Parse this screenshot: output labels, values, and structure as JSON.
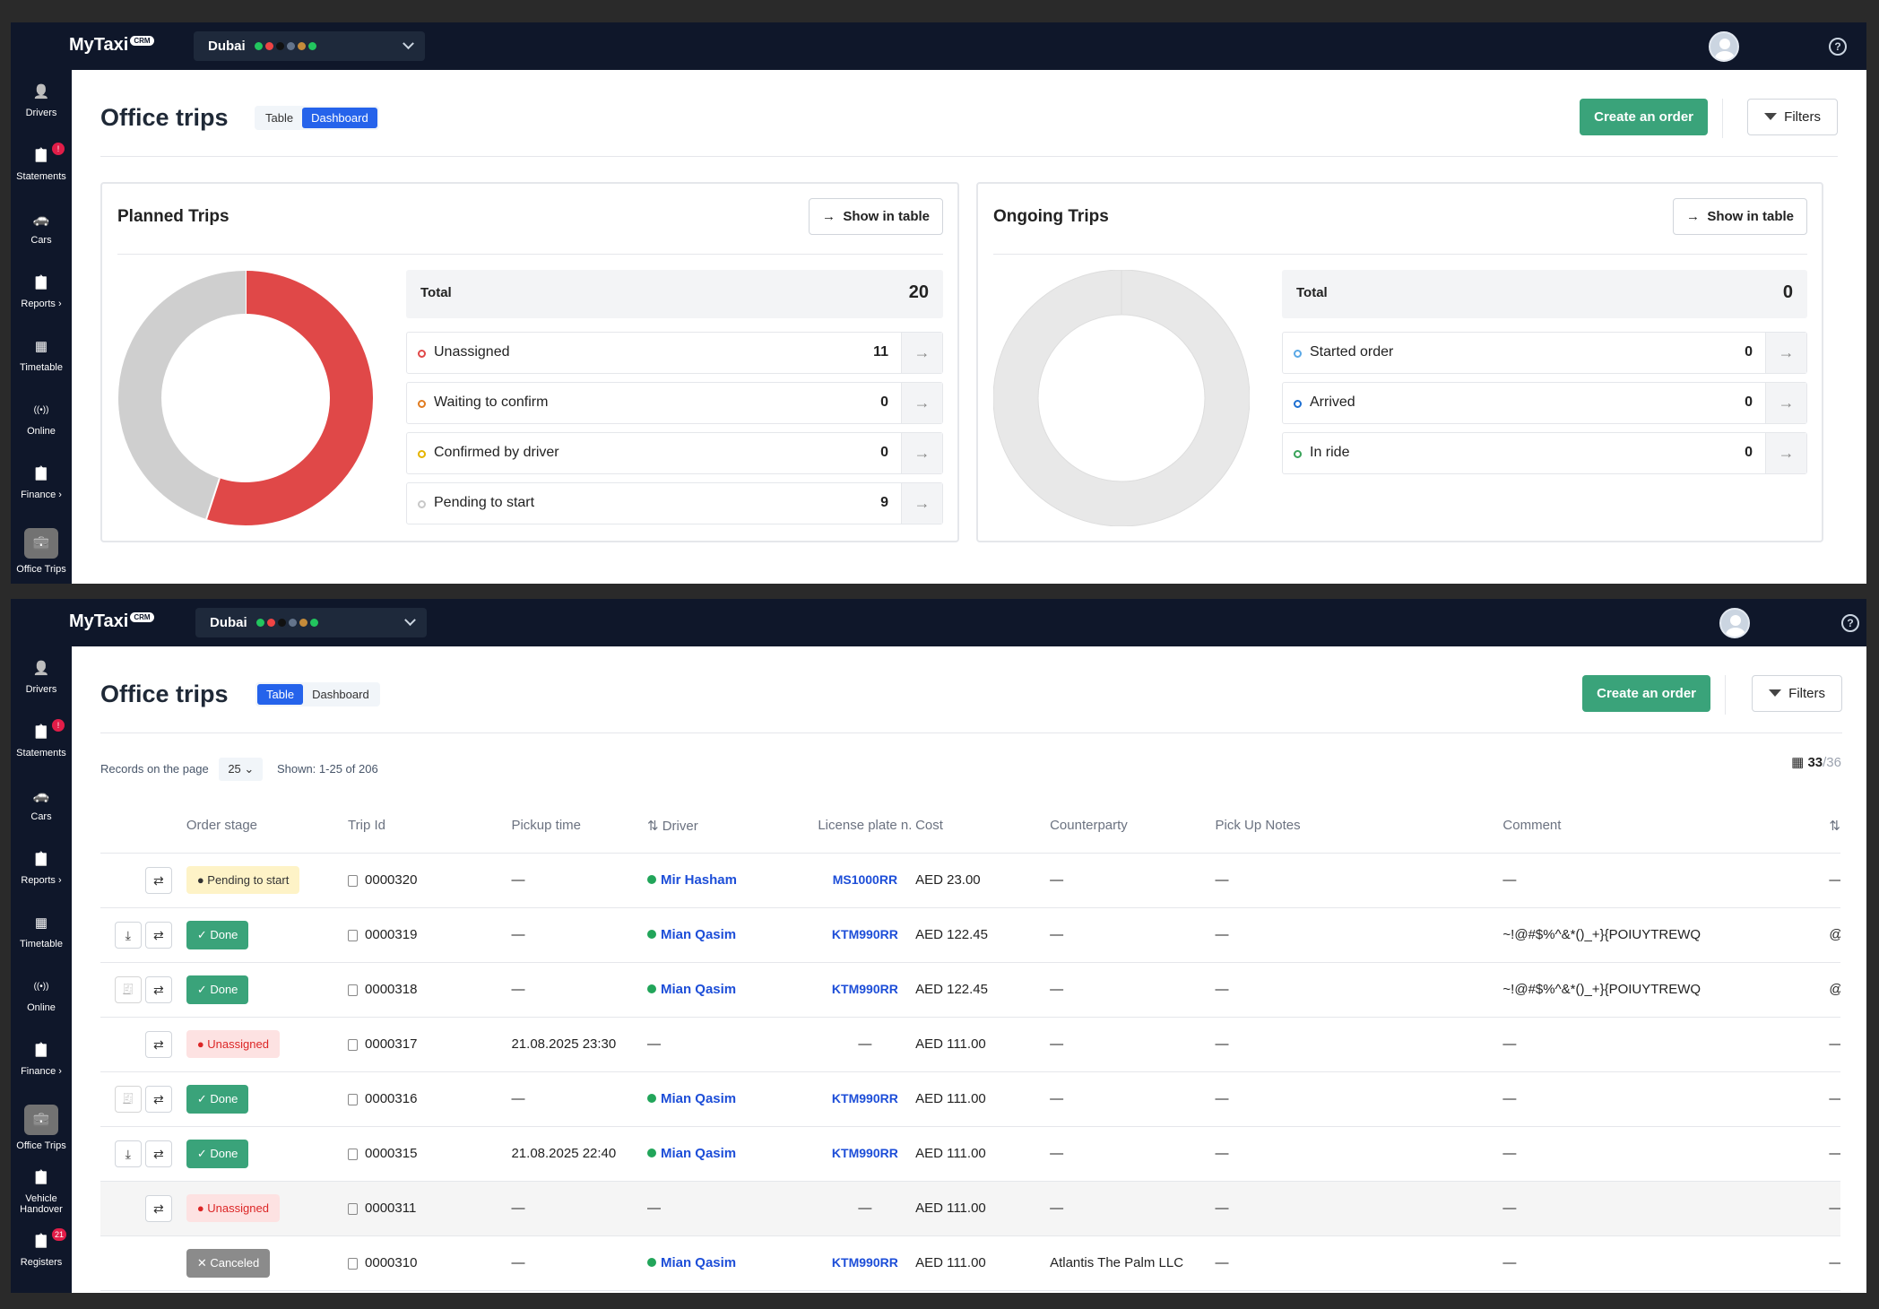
{
  "app": {
    "logo": "MyTaxi",
    "logo_badge": "CRM",
    "city": "Dubai",
    "help": "?"
  },
  "sidebar": {
    "frame1": [
      {
        "label": "Drivers",
        "icon": "user-icon"
      },
      {
        "label": "Statements",
        "icon": "clipboard-icon",
        "badge": "!"
      },
      {
        "label": "Cars",
        "icon": "car-icon"
      },
      {
        "label": "Reports ›",
        "icon": "clipboard-icon"
      },
      {
        "label": "Timetable",
        "icon": "calendar-icon"
      },
      {
        "label": "Online",
        "icon": "broadcast-icon"
      },
      {
        "label": "Finance ›",
        "icon": "clipboard-icon"
      },
      {
        "label": "Office Trips",
        "icon": "briefcase-icon",
        "active": true
      }
    ],
    "frame2": [
      {
        "label": "Drivers",
        "icon": "user-icon"
      },
      {
        "label": "Statements",
        "icon": "clipboard-icon",
        "badge": "!"
      },
      {
        "label": "Cars",
        "icon": "car-icon"
      },
      {
        "label": "Reports ›",
        "icon": "clipboard-icon"
      },
      {
        "label": "Timetable",
        "icon": "calendar-icon"
      },
      {
        "label": "Online",
        "icon": "broadcast-icon"
      },
      {
        "label": "Finance ›",
        "icon": "clipboard-icon"
      },
      {
        "label": "Office Trips",
        "icon": "briefcase-icon",
        "active": true
      },
      {
        "label": "Vehicle Handover",
        "icon": "clipboard-icon"
      },
      {
        "label": "Registers",
        "icon": "clipboard-icon",
        "badge": "21"
      }
    ]
  },
  "page": {
    "title": "Office trips",
    "tab_table": "Table",
    "tab_dashboard": "Dashboard",
    "create_button": "Create an order",
    "filters_button": "Filters"
  },
  "dashboard": {
    "planned": {
      "title": "Planned Trips",
      "show_in_table": "Show in table",
      "total_label": "Total",
      "total": "20",
      "rows": [
        {
          "label": "Unassigned",
          "count": "11",
          "color": "#e04848"
        },
        {
          "label": "Waiting to confirm",
          "count": "0",
          "color": "#e07b20"
        },
        {
          "label": "Confirmed by driver",
          "count": "0",
          "color": "#e5b400"
        },
        {
          "label": "Pending to start",
          "count": "9",
          "color": "#c8c8c8"
        }
      ]
    },
    "ongoing": {
      "title": "Ongoing Trips",
      "show_in_table": "Show in table",
      "total_label": "Total",
      "total": "0",
      "rows": [
        {
          "label": "Started order",
          "count": "0",
          "color": "#5aa8e6"
        },
        {
          "label": "Arrived",
          "count": "0",
          "color": "#1d6fd1"
        },
        {
          "label": "In ride",
          "count": "0",
          "color": "#3aa35a"
        }
      ]
    }
  },
  "table_view": {
    "records_label": "Records on the page",
    "records_value": "25",
    "shown": "Shown: 1-25 of 206",
    "columns_shown": "33",
    "columns_total": "/36",
    "headers": [
      "Order stage",
      "Trip Id",
      "Pickup time",
      "Driver",
      "License plate n.",
      "Cost",
      "Counterparty",
      "Pick Up Notes",
      "Comment"
    ],
    "rows": [
      {
        "actions": [
          "swap"
        ],
        "stage": "Pending to start",
        "stage_type": "pend",
        "trip_id": "0000320",
        "pickup": "—",
        "driver": "Mir Hasham",
        "plate": "MS1000RR",
        "cost": "AED 23.00",
        "counterparty": "—",
        "notes": "—",
        "comment": "—",
        "extra": "—"
      },
      {
        "actions": [
          "download",
          "swap"
        ],
        "stage": "Done",
        "stage_type": "done",
        "trip_id": "0000319",
        "pickup": "—",
        "driver": "Mian Qasim",
        "plate": "KTM990RR",
        "cost": "AED 122.45",
        "counterparty": "—",
        "notes": "—",
        "comment": "~!@#$%^&*()_+}{POIUYTREWQ",
        "extra": "@i"
      },
      {
        "actions": [
          "receipt",
          "swap"
        ],
        "stage": "Done",
        "stage_type": "done",
        "trip_id": "0000318",
        "pickup": "—",
        "driver": "Mian Qasim",
        "plate": "KTM990RR",
        "cost": "AED 122.45",
        "counterparty": "—",
        "notes": "—",
        "comment": "~!@#$%^&*()_+}{POIUYTREWQ",
        "extra": "@i"
      },
      {
        "actions": [
          "swap"
        ],
        "stage": "Unassigned",
        "stage_type": "un",
        "trip_id": "0000317",
        "pickup": "21.08.2025 23:30",
        "driver": "—",
        "plate": "—",
        "cost": "AED 111.00",
        "counterparty": "—",
        "notes": "—",
        "comment": "—",
        "extra": "—"
      },
      {
        "actions": [
          "receipt",
          "swap"
        ],
        "stage": "Done",
        "stage_type": "done",
        "trip_id": "0000316",
        "pickup": "—",
        "driver": "Mian Qasim",
        "plate": "KTM990RR",
        "cost": "AED 111.00",
        "counterparty": "—",
        "notes": "—",
        "comment": "—",
        "extra": "—"
      },
      {
        "actions": [
          "download",
          "swap"
        ],
        "stage": "Done",
        "stage_type": "done",
        "trip_id": "0000315",
        "pickup": "21.08.2025 22:40",
        "driver": "Mian Qasim",
        "plate": "KTM990RR",
        "cost": "AED 111.00",
        "counterparty": "—",
        "notes": "—",
        "comment": "—",
        "extra": "—"
      },
      {
        "actions": [
          "swap"
        ],
        "stage": "Unassigned",
        "stage_type": "un",
        "trip_id": "0000311",
        "pickup": "—",
        "driver": "—",
        "plate": "—",
        "cost": "AED 111.00",
        "counterparty": "—",
        "notes": "—",
        "comment": "—",
        "extra": "—",
        "highlight": true
      },
      {
        "actions": [],
        "stage": "Canceled",
        "stage_type": "can",
        "trip_id": "0000310",
        "pickup": "—",
        "driver": "Mian Qasim",
        "plate": "KTM990RR",
        "cost": "AED 111.00",
        "counterparty": "Atlantis The Palm LLC",
        "notes": "—",
        "comment": "—",
        "extra": "—"
      }
    ]
  }
}
